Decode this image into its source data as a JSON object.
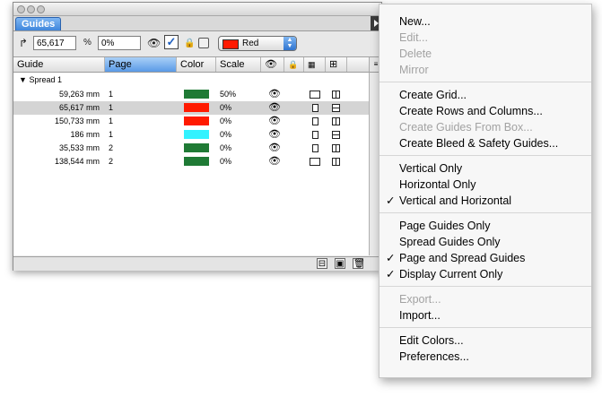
{
  "window": {
    "tab_label": "Guides"
  },
  "controls": {
    "position_value": "65,617",
    "scale_value": "0%",
    "color_name": "Red",
    "color_hex": "#ff1a00"
  },
  "columns": [
    "Guide",
    "Page",
    "Color",
    "Scale"
  ],
  "spread_label": "Spread 1",
  "rows": [
    {
      "guide": "59,263 mm",
      "page": "1",
      "color": "#1f7a35",
      "scale": "50%",
      "orient": "vertical",
      "selected": false
    },
    {
      "guide": "65,617 mm",
      "page": "1",
      "color": "#ff1a00",
      "scale": "0%",
      "orient": "horizontal",
      "selected": true
    },
    {
      "guide": "150,733 mm",
      "page": "1",
      "color": "#ff1a00",
      "scale": "0%",
      "orient": "vertical",
      "selected": false
    },
    {
      "guide": "186 mm",
      "page": "1",
      "color": "#33f2ff",
      "scale": "0%",
      "orient": "horizontal",
      "selected": false
    },
    {
      "guide": "35,533 mm",
      "page": "2",
      "color": "#1f7a35",
      "scale": "0%",
      "orient": "vertical",
      "selected": false
    },
    {
      "guide": "138,544 mm",
      "page": "2",
      "color": "#1f7a35",
      "scale": "0%",
      "orient": "vertical",
      "selected": false
    }
  ],
  "menu": [
    {
      "label": "New...",
      "enabled": true,
      "checked": false
    },
    {
      "label": "Edit...",
      "enabled": false,
      "checked": false
    },
    {
      "label": "Delete",
      "enabled": false,
      "checked": false
    },
    {
      "label": "Mirror",
      "enabled": false,
      "checked": false
    },
    {
      "separator": true
    },
    {
      "label": "Create Grid...",
      "enabled": true,
      "checked": false
    },
    {
      "label": "Create Rows and Columns...",
      "enabled": true,
      "checked": false
    },
    {
      "label": "Create Guides From Box...",
      "enabled": false,
      "checked": false
    },
    {
      "label": "Create Bleed & Safety Guides...",
      "enabled": true,
      "checked": false
    },
    {
      "separator": true
    },
    {
      "label": "Vertical Only",
      "enabled": true,
      "checked": false
    },
    {
      "label": "Horizontal Only",
      "enabled": true,
      "checked": false
    },
    {
      "label": "Vertical and Horizontal",
      "enabled": true,
      "checked": true
    },
    {
      "separator": true
    },
    {
      "label": "Page Guides Only",
      "enabled": true,
      "checked": false
    },
    {
      "label": "Spread Guides Only",
      "enabled": true,
      "checked": false
    },
    {
      "label": "Page and Spread Guides",
      "enabled": true,
      "checked": true
    },
    {
      "label": "Display Current Only",
      "enabled": true,
      "checked": true
    },
    {
      "separator": true
    },
    {
      "label": "Export...",
      "enabled": false,
      "checked": false
    },
    {
      "label": "Import...",
      "enabled": true,
      "checked": false
    },
    {
      "separator": true
    },
    {
      "label": "Edit Colors...",
      "enabled": true,
      "checked": false
    },
    {
      "label": "Preferences...",
      "enabled": true,
      "checked": false
    }
  ],
  "checkmark_glyph": "✓"
}
